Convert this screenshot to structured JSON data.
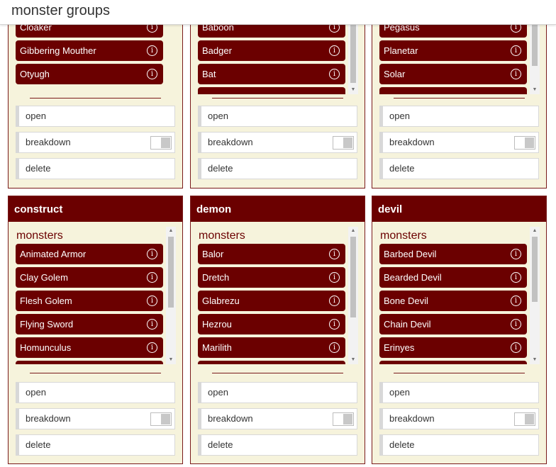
{
  "page_title": "monster groups",
  "icons": {
    "info": "info-circle-icon",
    "scroll_up": "triangle-up-icon",
    "scroll_down": "triangle-down-icon"
  },
  "colors": {
    "accent": "#6b0000",
    "card_bg": "#f6f3dc"
  },
  "actions": {
    "open": "open",
    "breakdown": "breakdown",
    "delete": "delete"
  },
  "top_groups": [
    {
      "monsters": [
        "Cloaker",
        "Gibbering Mouther",
        "Otyugh"
      ]
    },
    {
      "monsters": [
        "Baboon",
        "Badger",
        "Bat"
      ]
    },
    {
      "monsters": [
        "Pegasus",
        "Planetar",
        "Solar"
      ]
    }
  ],
  "bottom_groups": [
    {
      "name": "construct",
      "monsters_heading": "monsters",
      "monsters": [
        "Animated Armor",
        "Clay Golem",
        "Flesh Golem",
        "Flying Sword",
        "Homunculus"
      ]
    },
    {
      "name": "demon",
      "monsters_heading": "monsters",
      "monsters": [
        "Balor",
        "Dretch",
        "Glabrezu",
        "Hezrou",
        "Marilith"
      ]
    },
    {
      "name": "devil",
      "monsters_heading": "monsters",
      "monsters": [
        "Barbed Devil",
        "Bearded Devil",
        "Bone Devil",
        "Chain Devil",
        "Erinyes"
      ]
    }
  ]
}
